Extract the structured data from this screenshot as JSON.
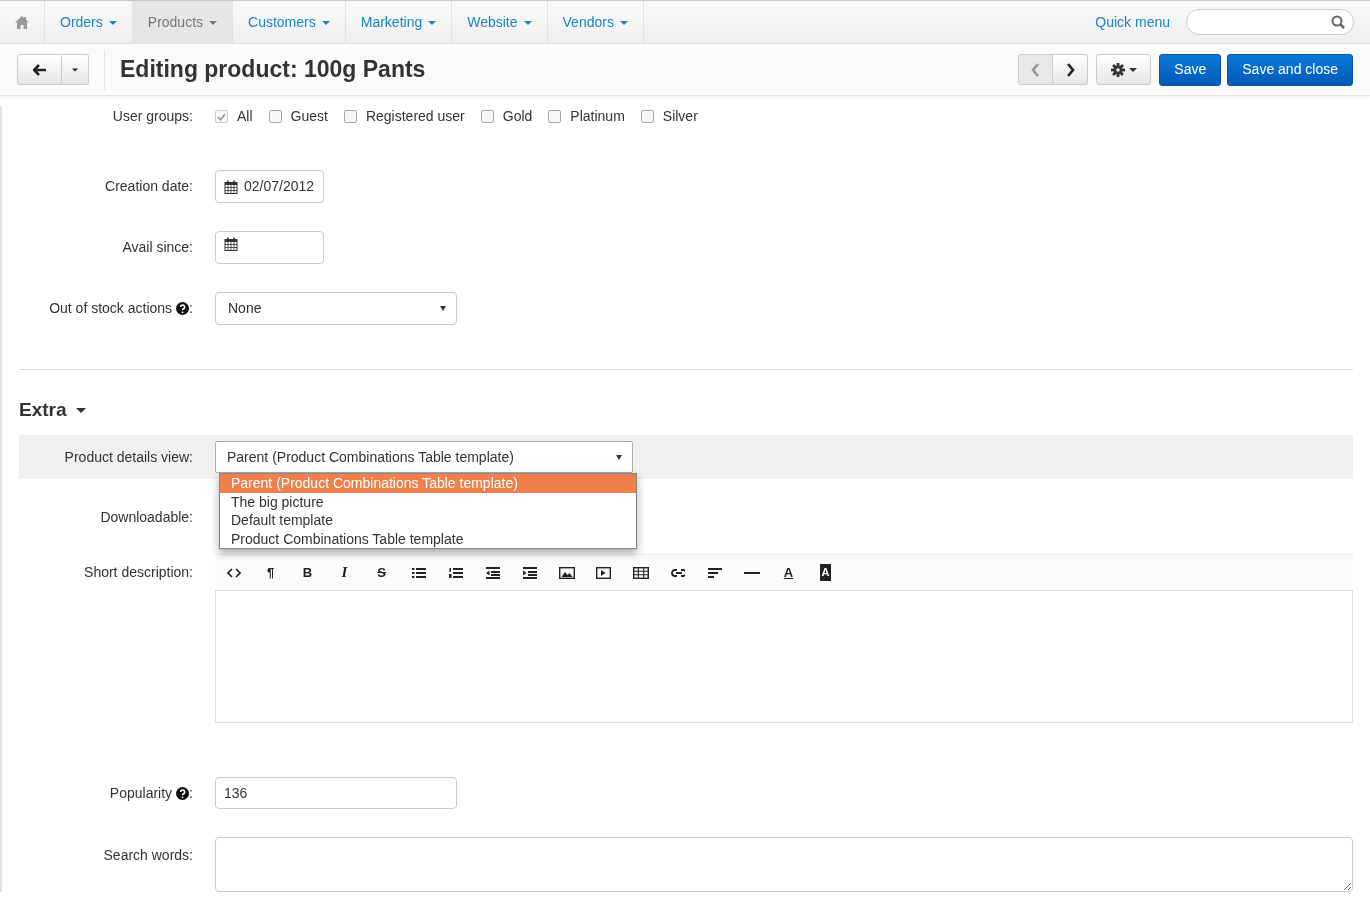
{
  "nav": {
    "items": [
      {
        "label": "Orders",
        "selected": false
      },
      {
        "label": "Products",
        "selected": true
      },
      {
        "label": "Customers",
        "selected": false
      },
      {
        "label": "Marketing",
        "selected": false
      },
      {
        "label": "Website",
        "selected": false
      },
      {
        "label": "Vendors",
        "selected": false
      }
    ],
    "quick_menu": "Quick menu"
  },
  "header": {
    "title": "Editing product: 100g Pants",
    "arrows": [
      {
        "disabled": true
      },
      {
        "disabled": false
      }
    ],
    "buttons": [
      "Save",
      "Save and close"
    ]
  },
  "user_groups": {
    "label": "User groups:",
    "options": [
      {
        "label": "All",
        "checked": true,
        "disabled": true
      },
      {
        "label": "Guest",
        "checked": false,
        "disabled": false
      },
      {
        "label": "Registered user",
        "checked": false,
        "disabled": false
      },
      {
        "label": "Gold",
        "checked": false,
        "disabled": false
      },
      {
        "label": "Platinum",
        "checked": false,
        "disabled": false
      },
      {
        "label": "Silver",
        "checked": false,
        "disabled": false
      }
    ]
  },
  "creation_date": {
    "label": "Creation date:",
    "value": "02/07/2012"
  },
  "avail_since": {
    "label": "Avail since:"
  },
  "out_of_stock": {
    "label": "Out of stock actions",
    "label_end": ":",
    "value": "None"
  },
  "extra": {
    "title": "Extra",
    "expanded": true
  },
  "product_details_view": {
    "label": "Product details view:",
    "value": "Parent (Product Combinations Table template)",
    "open": true,
    "options": [
      {
        "label": "Parent (Product Combinations Table template)",
        "selected": true
      },
      {
        "label": "The big picture",
        "selected": false
      },
      {
        "label": "Default template",
        "selected": false
      },
      {
        "label": "Product Combinations Table template",
        "selected": false
      }
    ]
  },
  "downloadable": {
    "label": "Downloadable:"
  },
  "short_description": {
    "label": "Short description:",
    "toolbar": [
      {
        "kind": "code"
      },
      {
        "kind": "paragraph",
        "glyph": "¶"
      },
      {
        "kind": "bold",
        "glyph": "B"
      },
      {
        "kind": "italic",
        "glyph": "I"
      },
      {
        "kind": "strike",
        "glyph": "S"
      },
      {
        "kind": "ul"
      },
      {
        "kind": "ol"
      },
      {
        "kind": "outdent"
      },
      {
        "kind": "indent"
      },
      {
        "kind": "image"
      },
      {
        "kind": "video"
      },
      {
        "kind": "table"
      },
      {
        "kind": "link"
      },
      {
        "kind": "align"
      },
      {
        "kind": "hr"
      },
      {
        "kind": "fontcolor",
        "glyph": "A"
      },
      {
        "kind": "bgcolor",
        "glyph": "A"
      }
    ]
  },
  "popularity": {
    "label": "Popularity",
    "label_end": ":",
    "value": "136"
  },
  "search_words": {
    "label": "Search words:"
  }
}
